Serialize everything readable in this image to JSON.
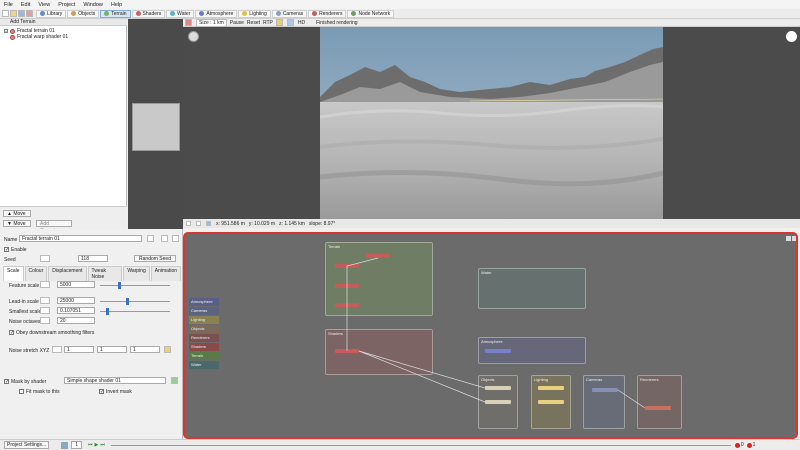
{
  "menu": [
    "File",
    "Edit",
    "View",
    "Project",
    "Window",
    "Help"
  ],
  "toolbar_tabs": [
    {
      "label": "Library",
      "color": "#5a8ed0"
    },
    {
      "label": "Objects",
      "color": "#d0a05a"
    },
    {
      "label": "Terrain",
      "color": "#7ab060",
      "active": true
    },
    {
      "label": "Shaders",
      "color": "#d06060"
    },
    {
      "label": "Water",
      "color": "#5ab0d0"
    },
    {
      "label": "Atmosphere",
      "color": "#6a7ad0"
    },
    {
      "label": "Lighting",
      "color": "#e0c040"
    },
    {
      "label": "Cameras",
      "color": "#8aa0c0"
    },
    {
      "label": "Renderers",
      "color": "#c06060"
    },
    {
      "label": "Node Network",
      "color": "#6aa060"
    }
  ],
  "left": {
    "add_terrain": "Add Terrain",
    "tree": [
      "Fractal terrain 01",
      "Fractal warp shader 01"
    ],
    "move_up": "Move",
    "move_down": "Move",
    "add_operator": "Add Operator"
  },
  "view_toolbar": {
    "size": "Size : 1 km",
    "pause": "Pause",
    "reset": "Reset",
    "rtp": "RTP",
    "hd": "HD",
    "status": "Finished rendering"
  },
  "view_status": {
    "x": "x: 951.586 m",
    "y": "y: 10.029 m",
    "z": "z: 1.145 km",
    "slope": "slope: 8.97°"
  },
  "params": {
    "name_label": "Name",
    "name": "Fractal terrain 01",
    "enable": "Enable",
    "seed_label": "Seed",
    "seed": "118",
    "random_seed": "Random Seed",
    "tabs": [
      "Scale",
      "Colour",
      "Displacement",
      "Tweak Noise",
      "Warping",
      "Animation"
    ],
    "feature_scale_label": "Feature scale",
    "feature_scale": "5000",
    "lead_in_label": "Lead-in scale",
    "lead_in": "25000",
    "smallest_label": "Smallest scale",
    "smallest": "0.107051",
    "octaves_label": "Noise octaves",
    "octaves": "20",
    "obey": "Obey downstream smoothing filters",
    "stretch_label": "Noise stretch XYZ",
    "stretch": [
      "1",
      "1",
      "1"
    ],
    "mask_label": "Mask by shader",
    "mask": "Simple shape shader 01",
    "fit_mask": "Fit mask to this",
    "invert_mask": "Invert mask"
  },
  "network": {
    "legend": [
      {
        "label": "Atmosphere",
        "color": "#5a5f8a"
      },
      {
        "label": "Cameras",
        "color": "#5a6480"
      },
      {
        "label": "Lighting",
        "color": "#8a8050"
      },
      {
        "label": "Objects",
        "color": "#7a6a5a"
      },
      {
        "label": "Renderers",
        "color": "#7a5050"
      },
      {
        "label": "Shaders",
        "color": "#8a4a4a"
      },
      {
        "label": "Terrain",
        "color": "#5a7a4a"
      },
      {
        "label": "Water",
        "color": "#4a6a6a"
      }
    ],
    "groups": {
      "terrain": "Terrain",
      "shaders": "Shaders",
      "water": "Water",
      "atmosphere": "Atmosphere",
      "objects": "Objects",
      "lighting": "Lighting",
      "cameras": "Cameras",
      "renderers": "Renderers"
    }
  },
  "status": {
    "project_settings": "Project Settings...",
    "frame": "1",
    "errors": "0",
    "warnings": "1"
  }
}
